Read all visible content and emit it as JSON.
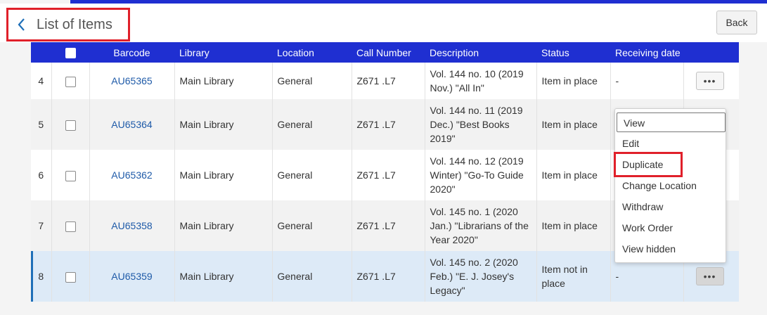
{
  "header": {
    "title": "List of Items",
    "back_label": "Back"
  },
  "table": {
    "columns": [
      "Barcode",
      "Library",
      "Location",
      "Call Number",
      "Description",
      "Status",
      "Receiving date"
    ],
    "rows": [
      {
        "num": "4",
        "barcode": "AU65365",
        "library": "Main Library",
        "location": "General",
        "call_number": "Z671 .L7",
        "description": "Vol. 144 no. 10 (2019 Nov.) \"All In\"",
        "status": "Item in place",
        "receiving_date": "-"
      },
      {
        "num": "5",
        "barcode": "AU65364",
        "library": "Main Library",
        "location": "General",
        "call_number": "Z671 .L7",
        "description": "Vol. 144 no. 11 (2019 Dec.) \"Best Books 2019\"",
        "status": "Item in place",
        "receiving_date": ""
      },
      {
        "num": "6",
        "barcode": "AU65362",
        "library": "Main Library",
        "location": "General",
        "call_number": "Z671 .L7",
        "description": "Vol. 144 no. 12 (2019 Winter) \"Go-To Guide 2020\"",
        "status": "Item in place",
        "receiving_date": ""
      },
      {
        "num": "7",
        "barcode": "AU65358",
        "library": "Main Library",
        "location": "General",
        "call_number": "Z671 .L7",
        "description": "Vol. 145 no. 1 (2020 Jan.) \"Librarians of the Year 2020\"",
        "status": "Item in place",
        "receiving_date": ""
      },
      {
        "num": "8",
        "barcode": "AU65359",
        "library": "Main Library",
        "location": "General",
        "call_number": "Z671 .L7",
        "description": "Vol. 145 no. 2 (2020 Feb.) \"E. J. Josey's Legacy\"",
        "status": "Item not in place",
        "receiving_date": "-"
      }
    ],
    "more_label": "•••"
  },
  "menu": {
    "items": [
      "View",
      "Edit",
      "Duplicate",
      "Change Location",
      "Withdraw",
      "Work Order",
      "View hidden"
    ]
  },
  "colors": {
    "accent": "#1f2fd1",
    "highlight": "#e0202a",
    "link": "#1e5aa8",
    "selected_row": "#ddeaf7"
  }
}
